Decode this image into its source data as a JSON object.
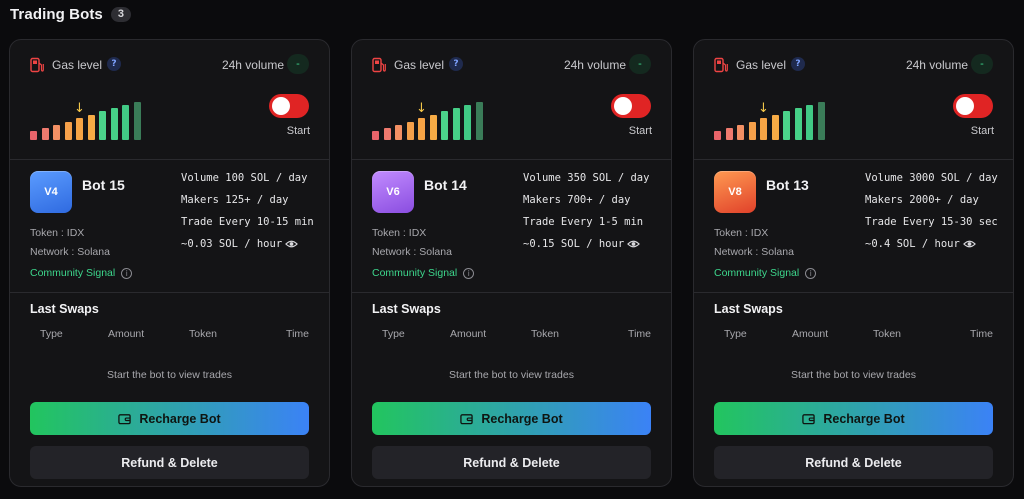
{
  "header": {
    "title": "Trading Bots",
    "count": "3"
  },
  "labels": {
    "gas_level": "Gas level",
    "help": "?",
    "vol24": "24h volume",
    "vol24_value": "-",
    "start": "Start",
    "last_swaps": "Last Swaps",
    "col_type": "Type",
    "col_amount": "Amount",
    "col_token": "Token",
    "col_time": "Time",
    "empty": "Start the bot to view trades",
    "recharge": "Recharge Bot",
    "refund": "Refund & Delete",
    "community_signal": "Community Signal",
    "info": "i"
  },
  "gas_level": {
    "bars": 10,
    "marker_bar": 4
  },
  "colors": {
    "gas_bars": [
      "#e8646a",
      "#ef7a6e",
      "#f39064",
      "#f5a04a",
      "#f6a445",
      "#f7ab45",
      "#4bd38a",
      "#46d087",
      "#41c985",
      "#3a7c58"
    ],
    "toggle_off": "#e02424",
    "accent_green": "#3dd68c"
  },
  "bots": [
    {
      "version": "V4",
      "name": "Bot 15",
      "token": "Token : IDX",
      "network": "Network : Solana",
      "volume": "Volume 100 SOL / day",
      "makers": "Makers 125+ / day",
      "trade": "Trade Every 10-15 min",
      "cost": "~0.03 SOL / hour",
      "avatar_from": "#5b9cff",
      "avatar_to": "#2f6ae0",
      "toggle": "off"
    },
    {
      "version": "V6",
      "name": "Bot 14",
      "token": "Token : IDX",
      "network": "Network : Solana",
      "volume": "Volume 350 SOL / day",
      "makers": "Makers 700+ / day",
      "trade": "Trade Every 1-5 min",
      "cost": "~0.15 SOL / hour",
      "avatar_from": "#c28cff",
      "avatar_to": "#8a4de0",
      "toggle": "off"
    },
    {
      "version": "V8",
      "name": "Bot 13",
      "token": "Token : IDX",
      "network": "Network : Solana",
      "volume": "Volume 3000 SOL / day",
      "makers": "Makers 2000+ / day",
      "trade": "Trade Every 15-30 sec",
      "cost": "~0.4 SOL / hour",
      "avatar_from": "#ff9a52",
      "avatar_to": "#e0412a",
      "toggle": "off"
    }
  ]
}
